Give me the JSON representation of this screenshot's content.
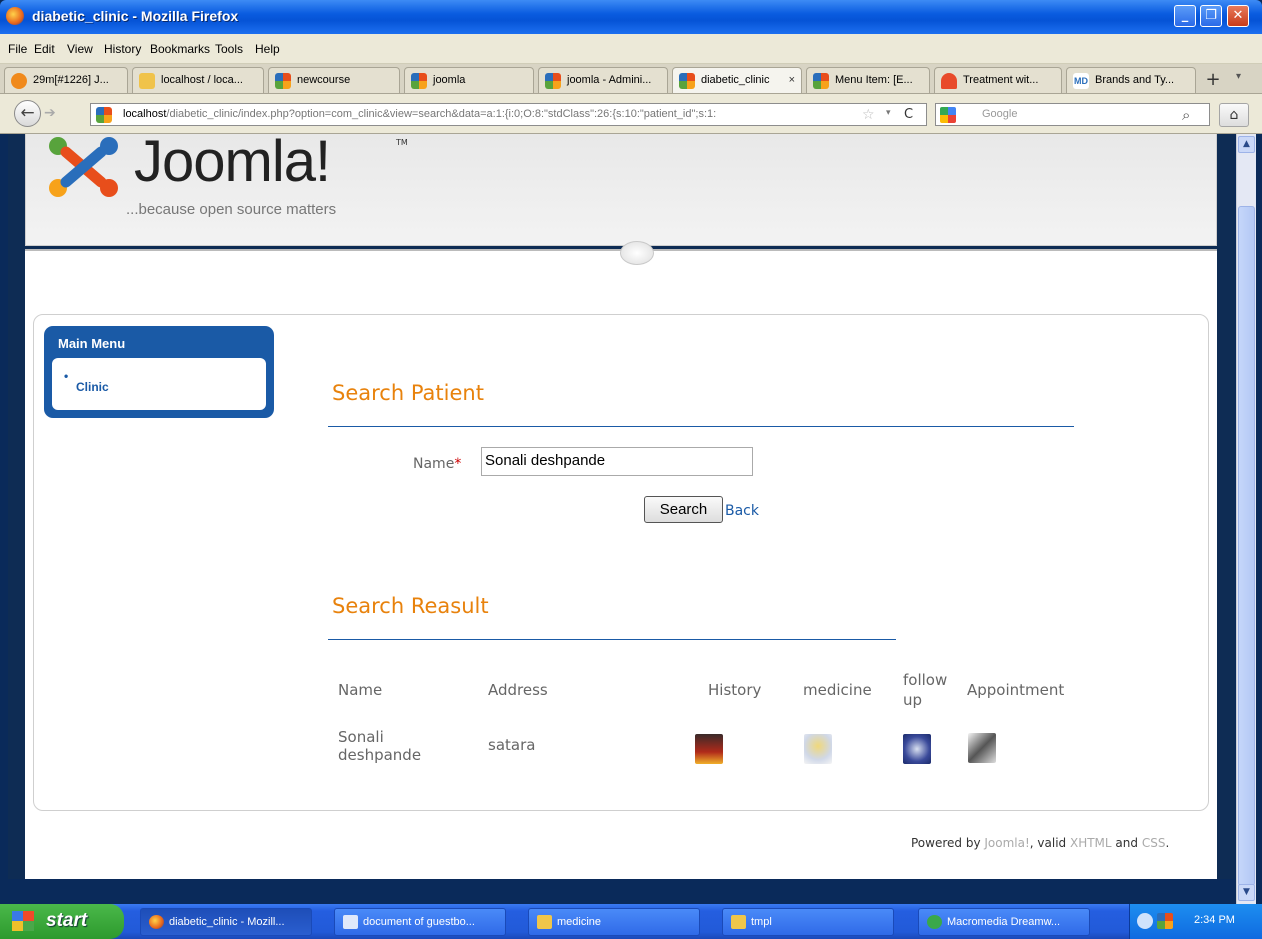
{
  "window": {
    "title": "diabetic_clinic - Mozilla Firefox"
  },
  "menubar": [
    "File",
    "Edit",
    "View",
    "History",
    "Bookmarks",
    "Tools",
    "Help"
  ],
  "tabs": [
    {
      "label": "29m[#1226] J...",
      "icon": "clock-icon"
    },
    {
      "label": "localhost / loca...",
      "icon": "phpmyadmin-icon"
    },
    {
      "label": "newcourse",
      "icon": "joomla-icon"
    },
    {
      "label": "joomla",
      "icon": "joomla-icon"
    },
    {
      "label": "joomla - Admini...",
      "icon": "joomla-icon"
    },
    {
      "label": "diabetic_clinic",
      "icon": "joomla-icon",
      "active": true
    },
    {
      "label": "Menu Item: [E...",
      "icon": "joomla-icon"
    },
    {
      "label": "Treatment wit...",
      "icon": "heart-icon"
    },
    {
      "label": "Brands and Ty...",
      "icon": "webmd-icon"
    }
  ],
  "tab_close": "×",
  "newtab": "+",
  "navbar": {
    "url_host": "localhost",
    "url_rest": "/diabetic_clinic/index.php?option=com_clinic&view=search&data=a:1:{i:0;O:8:\"stdClass\":26:{s:10:\"patient_id\";s:1:",
    "search_placeholder": "Google"
  },
  "joomla": {
    "logo": "Joomla!",
    "tm": "TM",
    "tagline": "...because open source matters"
  },
  "main_menu": {
    "title": "Main Menu",
    "items": [
      "Clinic"
    ]
  },
  "search_patient": {
    "heading": "Search Patient",
    "name_label": "Name",
    "required_mark": "*",
    "name_value": "Sonali deshpande",
    "search_button": "Search",
    "back_link": "Back"
  },
  "results": {
    "heading": "Search Reasult",
    "columns": [
      "Name",
      "Address",
      "History",
      "medicine",
      "follow up",
      "Appointment"
    ],
    "rows": [
      {
        "name": "Sonali deshpande",
        "address": "satara"
      }
    ]
  },
  "footer": {
    "powered_by": "Powered by ",
    "joomla_link": "Joomla!",
    "valid": ", valid ",
    "xhtml_link": "XHTML",
    "and": " and ",
    "css_link": "CSS",
    "end": "."
  },
  "taskbar": {
    "start": "start",
    "tasks": [
      "diabetic_clinic - Mozill...",
      "document of guestbo...",
      "medicine",
      "tmpl",
      "Macromedia Dreamw..."
    ],
    "clock": "2:34 PM"
  }
}
